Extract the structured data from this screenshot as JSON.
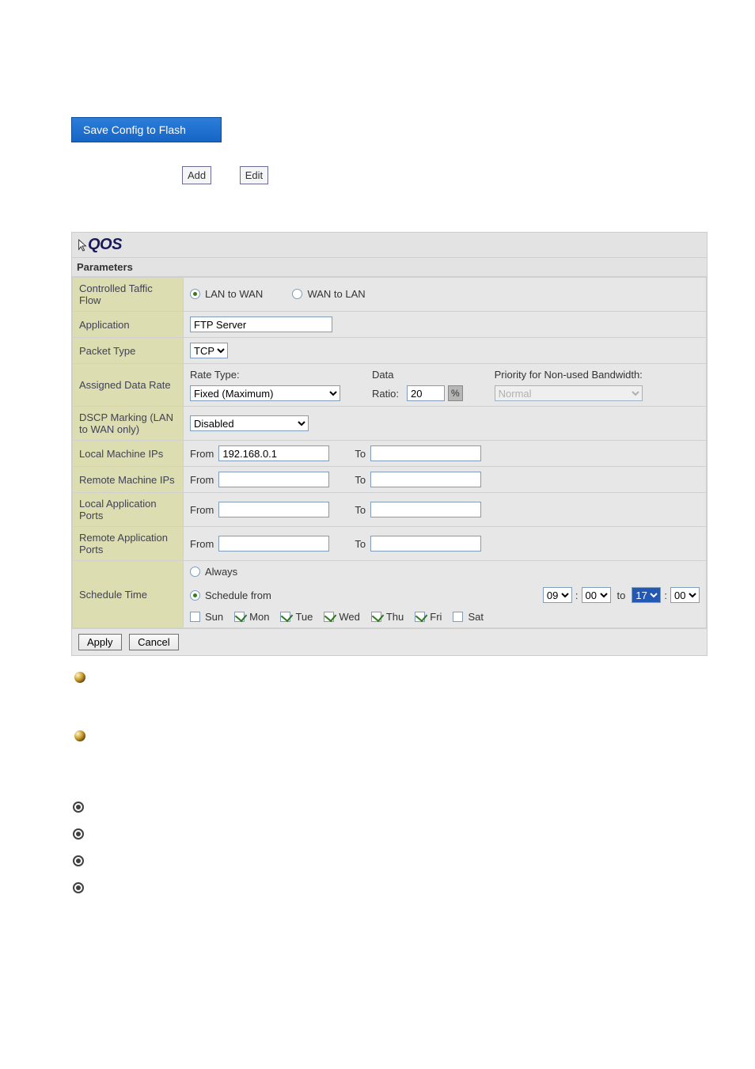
{
  "header": {
    "save_config": "Save Config to Flash",
    "add_button": "Add",
    "edit_button": "Edit"
  },
  "qos": {
    "title": "QOS",
    "parameters_label": "Parameters",
    "labels": {
      "controlled_traffic_flow": "Controlled Taffic Flow",
      "application": "Application",
      "packet_type": "Packet Type",
      "assigned_data_rate": "Assigned Data Rate",
      "dscp_marking": "DSCP Marking (LAN to WAN only)",
      "local_machine_ips": "Local Machine IPs",
      "remote_machine_ips": "Remote Machine IPs",
      "local_app_ports": "Local Application Ports",
      "remote_app_ports": "Remote Application Ports",
      "schedule_time": "Schedule Time"
    },
    "traffic_flow": {
      "lan_to_wan": "LAN to WAN",
      "wan_to_lan": "WAN to LAN",
      "selected": "lan_to_wan"
    },
    "application_value": "FTP Server",
    "packet_type_value": "TCP",
    "rate": {
      "rate_type_label": "Rate Type:",
      "rate_type_value": "Fixed (Maximum)",
      "data_ratio_label": "Data Ratio:",
      "data_ratio_value": "20",
      "percent_symbol": "%",
      "priority_label": "Priority for Non-used Bandwidth:",
      "priority_value": "Normal"
    },
    "dscp_value": "Disabled",
    "range_labels": {
      "from": "From",
      "to": "To"
    },
    "local_ips": {
      "from": "192.168.0.1",
      "to": ""
    },
    "remote_ips": {
      "from": "",
      "to": ""
    },
    "local_ports": {
      "from": "",
      "to": ""
    },
    "remote_ports": {
      "from": "",
      "to": ""
    },
    "schedule": {
      "always": "Always",
      "schedule_from": "Schedule from",
      "selected": "schedule_from",
      "from_hour": "09",
      "from_min": "00",
      "to_word": "to",
      "to_hour": "17",
      "to_min": "00",
      "colon": ":",
      "days": {
        "Sun": false,
        "Mon": true,
        "Tue": true,
        "Wed": true,
        "Thu": true,
        "Fri": true,
        "Sat": false
      }
    },
    "actions": {
      "apply": "Apply",
      "cancel": "Cancel"
    }
  }
}
